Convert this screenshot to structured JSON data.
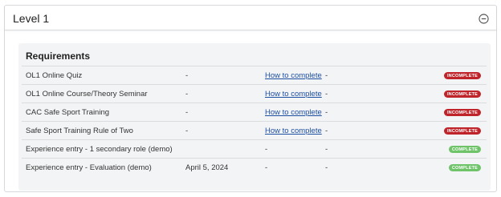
{
  "header": {
    "title": "Level 1"
  },
  "requirements": {
    "heading": "Requirements",
    "rows": [
      {
        "name": "OL1 Online Quiz",
        "date": "-",
        "link": "How to complete",
        "dash": "-",
        "status": "INCOMPLETE"
      },
      {
        "name": "OL1 Online Course/Theory Seminar",
        "date": "-",
        "link": "How to complete",
        "dash": "-",
        "status": "INCOMPLETE"
      },
      {
        "name": "CAC Safe Sport Training",
        "date": "-",
        "link": "How to complete",
        "dash": "-",
        "status": "INCOMPLETE"
      },
      {
        "name": "Safe Sport Training Rule of Two",
        "date": "-",
        "link": "How to complete",
        "dash": "-",
        "status": "INCOMPLETE"
      },
      {
        "name": "Experience entry - 1 secondary role (demo)",
        "date": "",
        "link": "-",
        "dash": "-",
        "status": "COMPLETE"
      },
      {
        "name": "Experience entry - Evaluation (demo)",
        "date": "April 5, 2024",
        "link": "-",
        "dash": "-",
        "status": "COMPLETE"
      }
    ]
  },
  "colors": {
    "incomplete": "#c0242b",
    "complete": "#6fc46a",
    "link": "#1d4fa0"
  },
  "icons": {
    "collapse": "minus-circle-icon"
  }
}
